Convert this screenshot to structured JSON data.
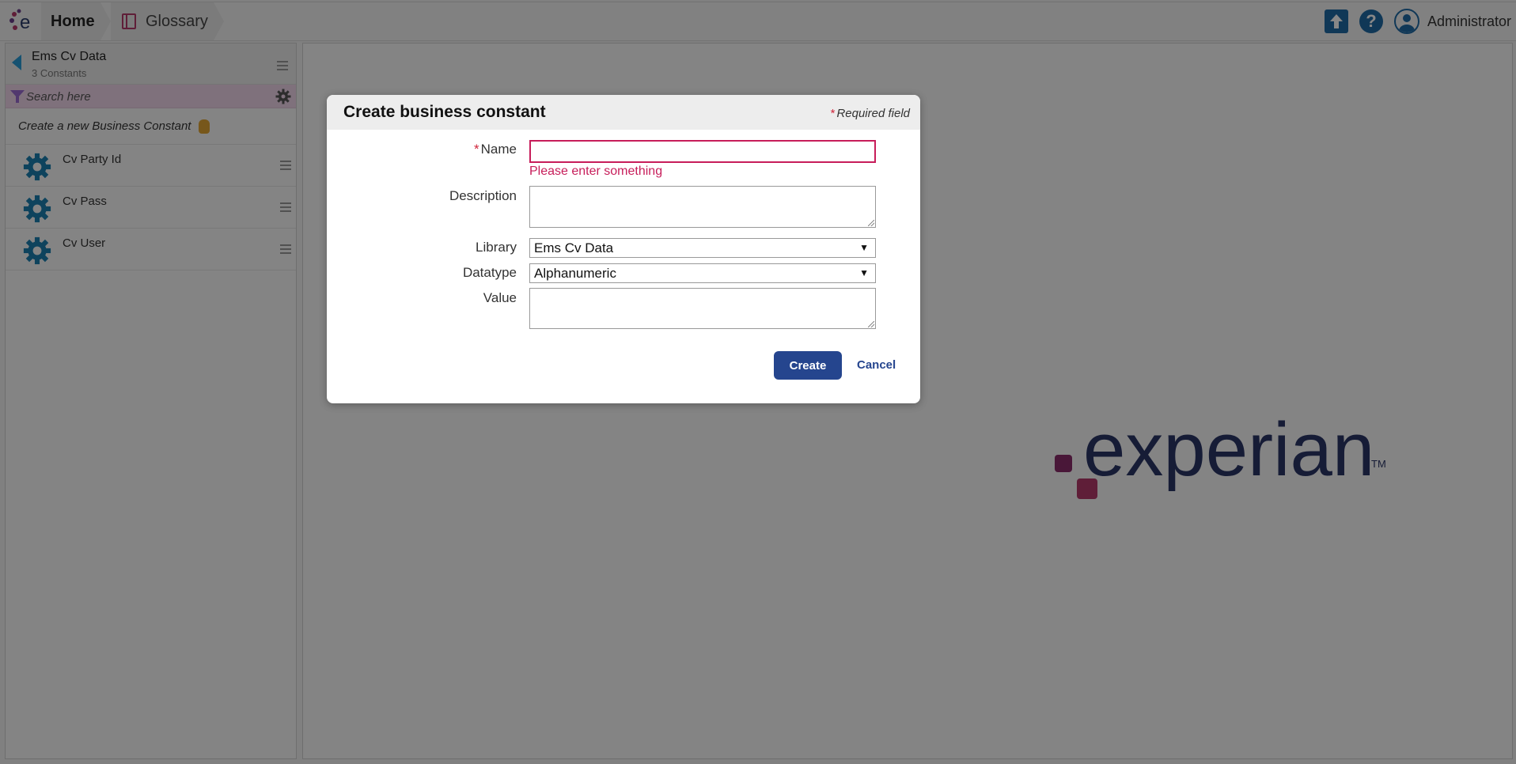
{
  "header": {
    "breadcrumb": [
      "Home",
      "Glossary"
    ],
    "user": "Administrator",
    "icons": [
      "app-logo-icon",
      "book-icon",
      "upload-icon",
      "help-icon",
      "user-icon"
    ],
    "accent": "#1f6aa5"
  },
  "sidebar": {
    "title": "Ems Cv Data",
    "subtitle": "3 Constants",
    "search_placeholder": "Search here",
    "create_label": "Create a new Business Constant",
    "items": [
      {
        "label": "Cv Party Id"
      },
      {
        "label": "Cv Pass"
      },
      {
        "label": "Cv User"
      }
    ]
  },
  "background": {
    "logo_text": "experian",
    "logo_tm": "TM"
  },
  "dialog": {
    "title": "Create business constant",
    "required_note": "Required field",
    "required_star": "*",
    "fields": {
      "name_label": "Name",
      "name_value": "",
      "name_error": "Please enter something",
      "description_label": "Description",
      "description_value": "",
      "library_label": "Library",
      "library_value": "Ems Cv Data",
      "datatype_label": "Datatype",
      "datatype_value": "Alphanumeric",
      "value_label": "Value",
      "value_value": ""
    },
    "create_label": "Create",
    "cancel_label": "Cancel",
    "error_color": "#c71d5a",
    "button_color": "#25458e"
  }
}
